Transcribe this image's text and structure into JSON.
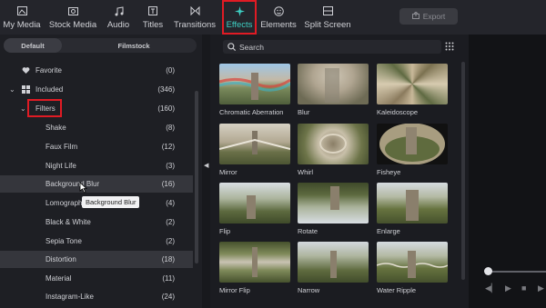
{
  "toolbar": {
    "tabs": [
      {
        "label": "My Media",
        "icon": "media-icon"
      },
      {
        "label": "Stock Media",
        "icon": "stock-media-icon"
      },
      {
        "label": "Audio",
        "icon": "music-note-icon"
      },
      {
        "label": "Titles",
        "icon": "titles-icon"
      },
      {
        "label": "Transitions",
        "icon": "transitions-icon"
      },
      {
        "label": "Effects",
        "icon": "sparkle-icon"
      },
      {
        "label": "Elements",
        "icon": "elements-icon"
      },
      {
        "label": "Split Screen",
        "icon": "split-screen-icon"
      }
    ],
    "active_tab": "Effects",
    "export_label": "Export"
  },
  "left": {
    "segments": {
      "default": "Default",
      "filmstock": "Filmstock"
    },
    "items": [
      {
        "label": "Favorite",
        "count": "(0)"
      },
      {
        "label": "Included",
        "count": "(346)"
      },
      {
        "label": "Filters",
        "count": "(160)"
      },
      {
        "label": "Shake",
        "count": "(8)"
      },
      {
        "label": "Faux Film",
        "count": "(12)"
      },
      {
        "label": "Night Life",
        "count": "(3)"
      },
      {
        "label": "Background Blur",
        "count": "(16)"
      },
      {
        "label": "Lomography",
        "count": "(4)"
      },
      {
        "label": "Black & White",
        "count": "(2)"
      },
      {
        "label": "Sepia Tone",
        "count": "(2)"
      },
      {
        "label": "Distortion",
        "count": "(18)"
      },
      {
        "label": "Material",
        "count": "(11)"
      },
      {
        "label": "Instagram-Like",
        "count": "(24)"
      }
    ],
    "tooltip": "Background Blur"
  },
  "search": {
    "placeholder": "Search"
  },
  "effects": [
    {
      "title": "Chromatic Aberration"
    },
    {
      "title": "Blur"
    },
    {
      "title": "Kaleidoscope"
    },
    {
      "title": "Mirror"
    },
    {
      "title": "Whirl"
    },
    {
      "title": "Fisheye"
    },
    {
      "title": "Flip"
    },
    {
      "title": "Rotate"
    },
    {
      "title": "Enlarge"
    },
    {
      "title": "Mirror Flip"
    },
    {
      "title": "Narrow"
    },
    {
      "title": "Water Ripple"
    }
  ],
  "colors": {
    "accent": "#3ed0c4",
    "highlight_box": "#e01b24"
  }
}
